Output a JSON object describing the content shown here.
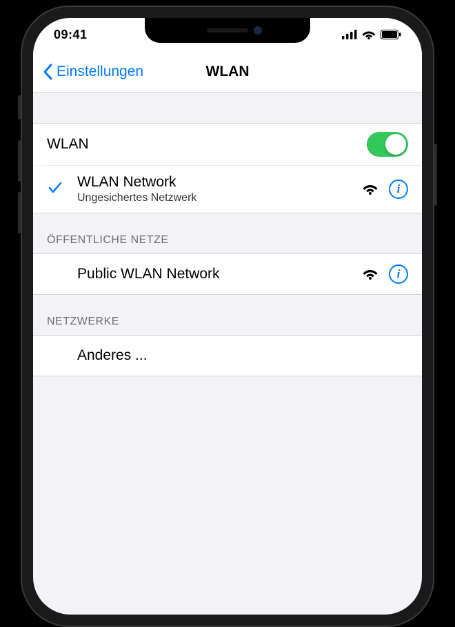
{
  "statusBar": {
    "time": "09:41"
  },
  "navBar": {
    "backLabel": "Einstellungen",
    "title": "WLAN"
  },
  "wlanToggle": {
    "label": "WLAN",
    "enabled": true
  },
  "connectedNetwork": {
    "name": "WLAN Network",
    "subtitle": "Ungesichertes Netzwerk",
    "connected": true
  },
  "sections": {
    "public": {
      "header": "ÖFFENTLICHE NETZE",
      "networks": [
        {
          "name": "Public WLAN Network"
        }
      ]
    },
    "other": {
      "header": "NETZWERKE",
      "otherLabel": "Anderes ..."
    }
  },
  "colors": {
    "accent": "#007aff",
    "toggleOn": "#34c759",
    "bg": "#f2f2f7"
  }
}
